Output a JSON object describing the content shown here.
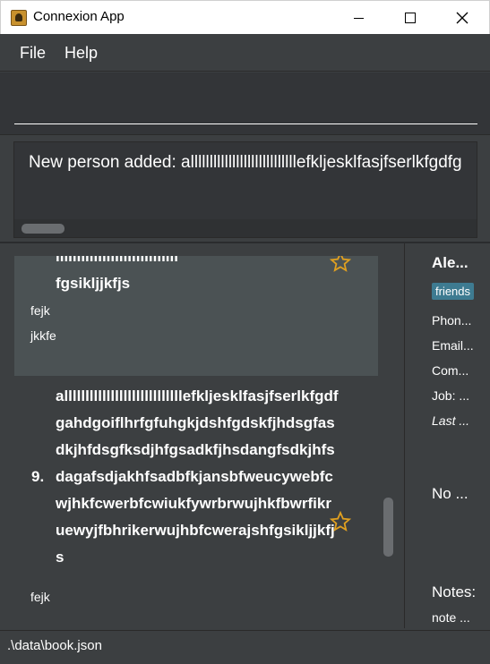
{
  "window": {
    "title": "Connexion App"
  },
  "menu": {
    "file": "File",
    "help": "Help"
  },
  "command": {
    "value": ""
  },
  "result": {
    "text": "New person added: allllllllllllllllllllllllllllefkljesklfasjfserlkfgdfg"
  },
  "list": {
    "cards": [
      {
        "name_lines": [
          "lllllllllllllllllllllllllllll",
          "fgsikljjkfjs"
        ],
        "fields": [
          "fejk",
          "jkkfe"
        ],
        "starred": true,
        "selected": true
      },
      {
        "index": "9.",
        "name_lines": [
          "allllllllllllllllllllllllllllefkljesklfasjfserlkfgdf",
          "gahdgoiflhrfgfuhgkjdshfgdskfjhdsgfas",
          "dkjhfdsgfksdjhfgsadkfjhsdangfsdkjhfs",
          "dagafsdjakhfsadbfkjansbfweucywebfc",
          "wjhkfcwerbfcwiukfywrbrwujhkfbwrfikr",
          "uewyjfbhrikerwujhbfcwerajshfgsikljjkfj",
          "s"
        ],
        "fields": [
          "fejk"
        ],
        "starred": true,
        "selected": false
      }
    ]
  },
  "detail": {
    "name": "Ale...",
    "tag": "friends",
    "phone": "Phon...",
    "email": "Email...",
    "company": "Com...",
    "job": "Job: ...",
    "last": "Last ...",
    "no": "No ...",
    "notes_label": "Notes:",
    "notes_value": "note ..."
  },
  "status": {
    "path": ".\\data\\book.json"
  },
  "colors": {
    "background": "#3c3f41",
    "selected_card": "#4b5254",
    "tag": "#3e7b91",
    "star": "#e0a020"
  }
}
